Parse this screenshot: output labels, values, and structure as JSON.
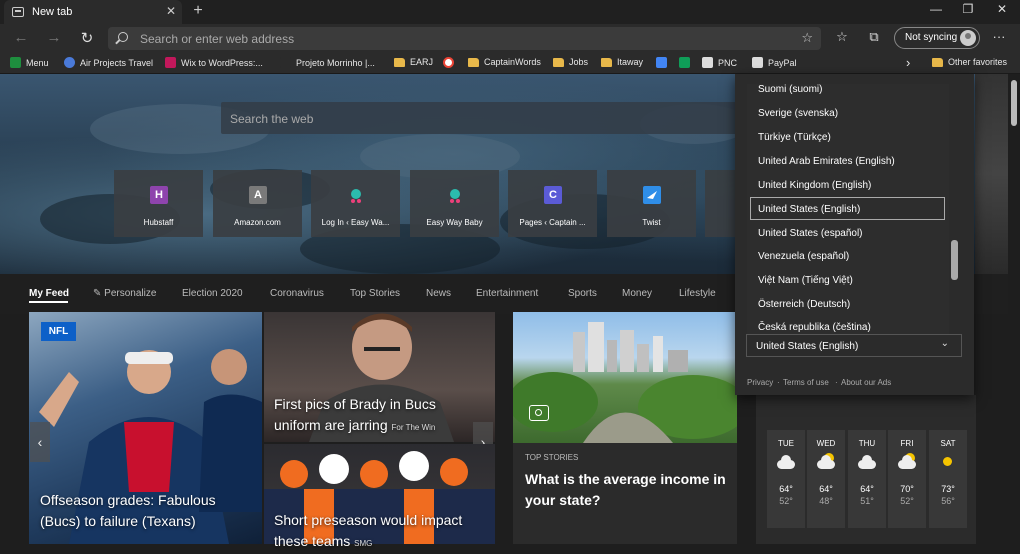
{
  "tab": {
    "title": "New tab",
    "close": "✕",
    "new_tab": "+"
  },
  "window": {
    "minimize": "—",
    "restore": "❐",
    "close": "✕"
  },
  "toolbar": {
    "back": "←",
    "forward": "→",
    "refresh": "↻",
    "address_placeholder": "Search or enter web address",
    "favorite": "☆",
    "favorites_hub": "☆",
    "collections": "⧉",
    "more": "···",
    "sync_label": "Not syncing"
  },
  "bookmarks": [
    {
      "label": "Menu",
      "icon": "ck-icon",
      "color": "#1e8e3e"
    },
    {
      "label": "Air Projects Travel",
      "icon": "plane-icon",
      "color": "#4a7ad9"
    },
    {
      "label": "Wix to WordPress:...",
      "icon": "wix-icon",
      "color": "#c2185b"
    },
    {
      "label": "Projeto Morrinho |...",
      "icon": "page-icon",
      "color": "#2b2b2b"
    },
    {
      "label": "EARJ",
      "icon": "folder-icon",
      "color": "#e8b84a"
    },
    {
      "label": "",
      "icon": "google-icon",
      "color": "#ffffff"
    },
    {
      "label": "CaptainWords",
      "icon": "folder-icon",
      "color": "#e8b84a"
    },
    {
      "label": "Jobs",
      "icon": "folder-icon",
      "color": "#e8b84a"
    },
    {
      "label": "Itaway",
      "icon": "folder-icon",
      "color": "#e8b84a"
    },
    {
      "label": "",
      "icon": "docs-icon",
      "color": "#4285f4"
    },
    {
      "label": "",
      "icon": "sheets-icon",
      "color": "#0f9d58"
    },
    {
      "label": "PNC",
      "icon": "page-icon",
      "color": "#dddddd"
    },
    {
      "label": "PayPal",
      "icon": "page-icon",
      "color": "#dddddd"
    }
  ],
  "bookmarks_more": "›",
  "other_favorites": "Other favorites",
  "web_search_placeholder": "Search the web",
  "tiles": [
    {
      "label": "Hubstaff",
      "letter": "H",
      "color": "#8e44ad"
    },
    {
      "label": "Amazon.com",
      "letter": "A",
      "color": "#7a7a7a"
    },
    {
      "label": "Log In ‹ Easy Wa...",
      "letter": "",
      "color": "#2bbbad"
    },
    {
      "label": "Easy Way Baby",
      "letter": "",
      "color": "#2bbbad"
    },
    {
      "label": "Pages ‹ Captain ...",
      "letter": "C",
      "color": "#5b5bd6"
    },
    {
      "label": "Twist",
      "letter": "",
      "color": "#2f8ee8"
    }
  ],
  "feed_nav": {
    "items": [
      "My Feed",
      "Personalize",
      "Election 2020",
      "Coronavirus",
      "Top Stories",
      "News",
      "Entertainment",
      "Sports",
      "Money",
      "Lifestyle"
    ],
    "personalize_icon": "✎"
  },
  "cards": {
    "nfl": {
      "badge": "NFL",
      "headline": "Offseason grades: Fabulous (Bucs) to failure (Texans)"
    },
    "brady": {
      "headline": "First pics of Brady in Bucs uniform are jarring",
      "source": "For The Win"
    },
    "broncos": {
      "headline": "Short preseason would impact these teams",
      "source": "SMG"
    },
    "top_story": {
      "label": "TOP STORIES",
      "headline": "What is the average income in your state?"
    },
    "prev": "‹",
    "next": "›"
  },
  "weather": [
    {
      "day": "TUE",
      "hi": "64°",
      "lo": "52°",
      "icon": "cloudy-icon"
    },
    {
      "day": "WED",
      "hi": "64°",
      "lo": "48°",
      "icon": "partly-sunny-icon"
    },
    {
      "day": "THU",
      "hi": "64°",
      "lo": "51°",
      "icon": "cloudy-icon"
    },
    {
      "day": "FRI",
      "hi": "70°",
      "lo": "52°",
      "icon": "partly-sunny-icon"
    },
    {
      "day": "SAT",
      "hi": "73°",
      "lo": "56°",
      "icon": "sunny-icon"
    }
  ],
  "language_dropdown": {
    "options": [
      "Suomi (suomi)",
      "Sverige (svenska)",
      "Türkiye (Türkçe)",
      "United Arab Emirates (English)",
      "United Kingdom (English)",
      "United States (English)",
      "United States (español)",
      "Venezuela (español)",
      "Việt Nam (Tiếng Việt)",
      "Österreich (Deutsch)",
      "Česká republika (čeština)"
    ],
    "highlighted": "United States (English)",
    "selected": "United States (English)",
    "chevron": "⌄",
    "footer": [
      "Privacy",
      "·",
      "Terms of use",
      "·",
      "About our Ads"
    ]
  },
  "settings_icon": "⚙"
}
